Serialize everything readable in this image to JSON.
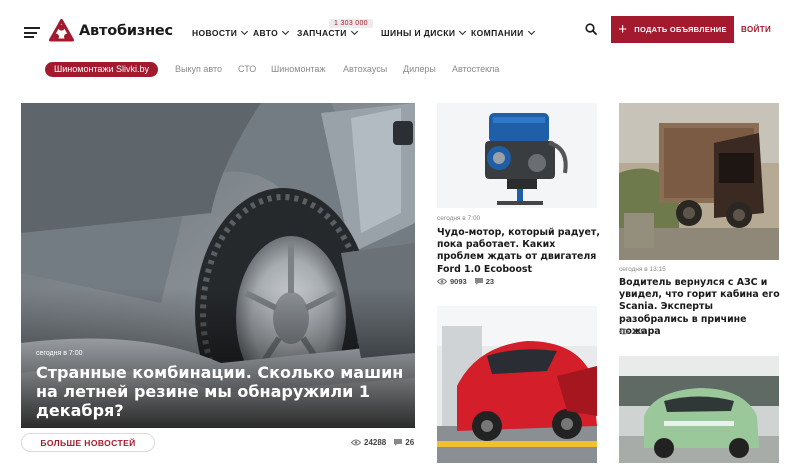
{
  "header": {
    "logo_text": "Автобизнес",
    "nav": [
      {
        "label": "НОВОСТИ"
      },
      {
        "label": "АВТО"
      },
      {
        "label": "ЗАПЧАСТИ"
      },
      {
        "label": "ШИНЫ И ДИСКИ"
      },
      {
        "label": "КОМПАНИИ"
      }
    ],
    "parts_badge": "1 303 000",
    "post_button": "ПОДАТЬ ОБЪЯВЛЕНИЕ",
    "login": "ВОЙТИ",
    "accent_color": "#a31a2f"
  },
  "subnav": {
    "active": "Шиномонтажи Slivki.by",
    "links": [
      "Выкуп авто",
      "СТО",
      "Шиномонтаж",
      "Автохаусы",
      "Дилеры",
      "Автостекла"
    ]
  },
  "hero": {
    "time": "сегодня в 7:00",
    "title": "Странные комбинации. Сколько машин на летней резине мы обнаружили 1 декабря?",
    "views": "24288",
    "comments": "26",
    "more_button": "БОЛЬШЕ НОВОСТЕЙ"
  },
  "cards": [
    {
      "time": "сегодня в 7:00",
      "title": "Чудо-мотор, который радует, пока работает. Каких проблем ждать от двигателя Ford 1.0 Ecoboost",
      "views": "9093",
      "comments": "23"
    },
    {
      "time": "сегодня в 13:15",
      "title": "Водитель вернулся с АЗС и увидел, что горит кабина его Scania. Эксперты разобрались в причине пожара",
      "views": "235"
    }
  ]
}
